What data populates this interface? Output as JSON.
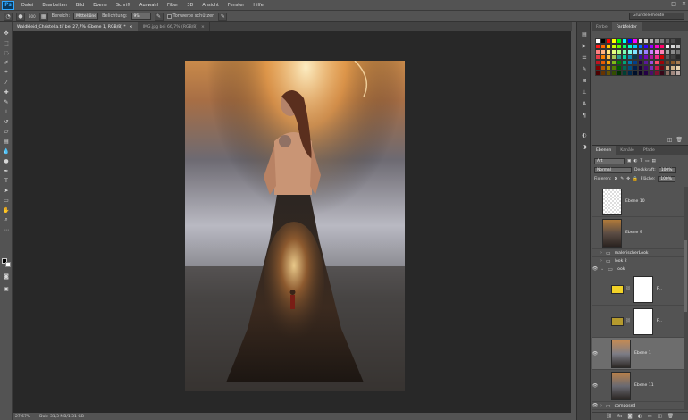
{
  "menu": {
    "logo": "Ps",
    "items": [
      "Datei",
      "Bearbeiten",
      "Bild",
      "Ebene",
      "Schrift",
      "Auswahl",
      "Filter",
      "3D",
      "Ansicht",
      "Fenster",
      "Hilfe"
    ]
  },
  "options": {
    "size_value": "300",
    "range_label": "Bereich:",
    "range_value": "Mitteltöne",
    "exposure_label": "Belichtung:",
    "exposure_value": "9%",
    "protect_label": "Tonwerte schützen",
    "workspace": "Grundelemente"
  },
  "tabs": [
    {
      "label": "Waldkleid_Christella.tif bei 27,7% (Ebene 1, RGB/8) *",
      "close": "×"
    },
    {
      "label": "IMG.jpg bei 66,7% (RGB/8)",
      "close": "×"
    }
  ],
  "status": {
    "zoom": "27,67%",
    "doc": "Dok: 31,3 MB/1,31 GB"
  },
  "swatches_panel": {
    "tab_color": "Farbe",
    "tab_swatches": "Farbfelder",
    "colors": [
      "#ffffff",
      "#000000",
      "#ff0000",
      "#ffff00",
      "#00ff00",
      "#00ffff",
      "#0000ff",
      "#ff00ff",
      "#e6e6e6",
      "#cccccc",
      "#b3b3b3",
      "#999999",
      "#808080",
      "#666666",
      "#4d4d4d",
      "#333333",
      "#ff1a1a",
      "#ff6600",
      "#ffcc00",
      "#ccff00",
      "#66ff00",
      "#00ff66",
      "#00ffcc",
      "#00ccff",
      "#0066ff",
      "#3300ff",
      "#9900ff",
      "#ff00cc",
      "#ff0066",
      "#f2f2f2",
      "#d9d9d9",
      "#bfbfbf",
      "#ff8080",
      "#ffb380",
      "#ffe680",
      "#e6ff80",
      "#b3ff80",
      "#80ffb3",
      "#80ffe6",
      "#80e6ff",
      "#80b3ff",
      "#9980ff",
      "#cc80ff",
      "#ff80e6",
      "#ff80b3",
      "#a6a6a6",
      "#8c8c8c",
      "#737373",
      "#e63946",
      "#f77f00",
      "#fcbf49",
      "#a7c957",
      "#2a9d8f",
      "#06d6a0",
      "#118ab2",
      "#073b4c",
      "#3a0ca3",
      "#7209b7",
      "#b5179e",
      "#f72585",
      "#d00000",
      "#5a5a5a",
      "#414141",
      "#282828",
      "#c1121f",
      "#e85d04",
      "#faa307",
      "#80b918",
      "#008000",
      "#00a676",
      "#0077b6",
      "#023e8a",
      "#240046",
      "#5a189a",
      "#9d4edd",
      "#ff4d6d",
      "#9d0208",
      "#6b4226",
      "#8b5a2b",
      "#a67c52",
      "#800000",
      "#b35900",
      "#b38f00",
      "#557a00",
      "#005c00",
      "#006650",
      "#004d80",
      "#001f4d",
      "#1a0033",
      "#3c096c",
      "#7b2cbf",
      "#c9184a",
      "#6a040f",
      "#c9a27e",
      "#d2b48c",
      "#e8d3b0",
      "#4d0000",
      "#663300",
      "#665200",
      "#334d00",
      "#003300",
      "#004033",
      "#00294d",
      "#00102b",
      "#10002b",
      "#240046",
      "#4a0e6b",
      "#800f2f",
      "#370617",
      "#8d6e63",
      "#a1887f",
      "#bcaaa4"
    ]
  },
  "layers_panel": {
    "tab_layers": "Ebenen",
    "tab_channels": "Kanäle",
    "tab_paths": "Pfade",
    "filter_kind": "Art",
    "blend_mode": "Normal",
    "opacity_label": "Deckkraft:",
    "opacity_value": "100%",
    "lock_label": "Fixieren:",
    "fill_label": "Fläche:",
    "fill_value": "100%",
    "layers": [
      {
        "name": "Ebene 10",
        "eye": "",
        "kind": "thumb-trans"
      },
      {
        "name": "Ebene 9",
        "eye": "",
        "kind": "thumb-photo"
      },
      {
        "name": "malerischerLook",
        "eye": "",
        "kind": "folder"
      },
      {
        "name": "look 2",
        "eye": "",
        "kind": "folder"
      },
      {
        "name": "look",
        "eye": "👁",
        "kind": "folder-open"
      },
      {
        "name": "F...",
        "eye": "",
        "kind": "adj-yellow"
      },
      {
        "name": "F...",
        "eye": "",
        "kind": "adj-olive"
      },
      {
        "name": "Ebene 1",
        "eye": "👁",
        "kind": "thumb-photo",
        "selected": true
      },
      {
        "name": "Ebene 11",
        "eye": "👁",
        "kind": "thumb-photo"
      },
      {
        "name": "composed",
        "eye": "👁",
        "kind": "folder"
      }
    ]
  }
}
